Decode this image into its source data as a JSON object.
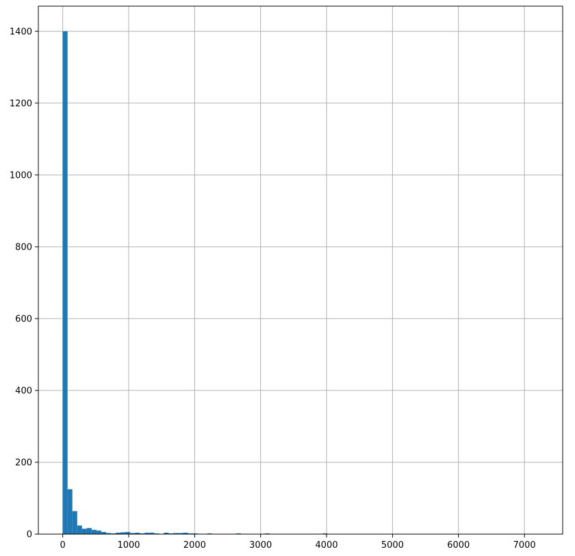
{
  "chart_data": {
    "type": "bar",
    "title": "",
    "xlabel": "",
    "ylabel": "",
    "grid": true,
    "xlim": [
      -370,
      7580
    ],
    "ylim": [
      0,
      1470
    ],
    "bin_width": 73,
    "bins": [
      {
        "x0": 0,
        "x1": 73,
        "count": 1400
      },
      {
        "x0": 73,
        "x1": 146,
        "count": 125
      },
      {
        "x0": 146,
        "x1": 219,
        "count": 64
      },
      {
        "x0": 219,
        "x1": 292,
        "count": 24
      },
      {
        "x0": 292,
        "x1": 365,
        "count": 15
      },
      {
        "x0": 365,
        "x1": 438,
        "count": 17
      },
      {
        "x0": 438,
        "x1": 511,
        "count": 12
      },
      {
        "x0": 511,
        "x1": 584,
        "count": 10
      },
      {
        "x0": 584,
        "x1": 657,
        "count": 6
      },
      {
        "x0": 657,
        "x1": 730,
        "count": 3
      },
      {
        "x0": 730,
        "x1": 803,
        "count": 2
      },
      {
        "x0": 803,
        "x1": 876,
        "count": 4
      },
      {
        "x0": 876,
        "x1": 949,
        "count": 5
      },
      {
        "x0": 949,
        "x1": 1022,
        "count": 6
      },
      {
        "x0": 1022,
        "x1": 1095,
        "count": 3
      },
      {
        "x0": 1095,
        "x1": 1168,
        "count": 4
      },
      {
        "x0": 1168,
        "x1": 1241,
        "count": 2
      },
      {
        "x0": 1241,
        "x1": 1314,
        "count": 4
      },
      {
        "x0": 1314,
        "x1": 1387,
        "count": 4
      },
      {
        "x0": 1387,
        "x1": 1460,
        "count": 2
      },
      {
        "x0": 1460,
        "x1": 1533,
        "count": 1
      },
      {
        "x0": 1533,
        "x1": 1606,
        "count": 4
      },
      {
        "x0": 1606,
        "x1": 1679,
        "count": 2
      },
      {
        "x0": 1679,
        "x1": 1752,
        "count": 3
      },
      {
        "x0": 1752,
        "x1": 1825,
        "count": 3
      },
      {
        "x0": 1825,
        "x1": 1898,
        "count": 4
      },
      {
        "x0": 1898,
        "x1": 1971,
        "count": 2
      },
      {
        "x0": 1971,
        "x1": 2044,
        "count": 2
      },
      {
        "x0": 2044,
        "x1": 2117,
        "count": 1
      },
      {
        "x0": 2190,
        "x1": 2263,
        "count": 2
      },
      {
        "x0": 2628,
        "x1": 2701,
        "count": 2
      },
      {
        "x0": 3066,
        "x1": 3139,
        "count": 2
      },
      {
        "x0": 3942,
        "x1": 4015,
        "count": 2
      }
    ],
    "xticks": [
      "0",
      "1000",
      "2000",
      "3000",
      "4000",
      "5000",
      "6000",
      "7000"
    ],
    "xtick_values": [
      0,
      1000,
      2000,
      3000,
      4000,
      5000,
      6000,
      7000
    ],
    "yticks": [
      "0",
      "200",
      "400",
      "600",
      "800",
      "1000",
      "1200",
      "1400"
    ],
    "ytick_values": [
      0,
      200,
      400,
      600,
      800,
      1000,
      1200,
      1400
    ],
    "colors": {
      "bar": "#1f77b4",
      "grid": "#b0b0b0",
      "axis": "#000000"
    }
  }
}
